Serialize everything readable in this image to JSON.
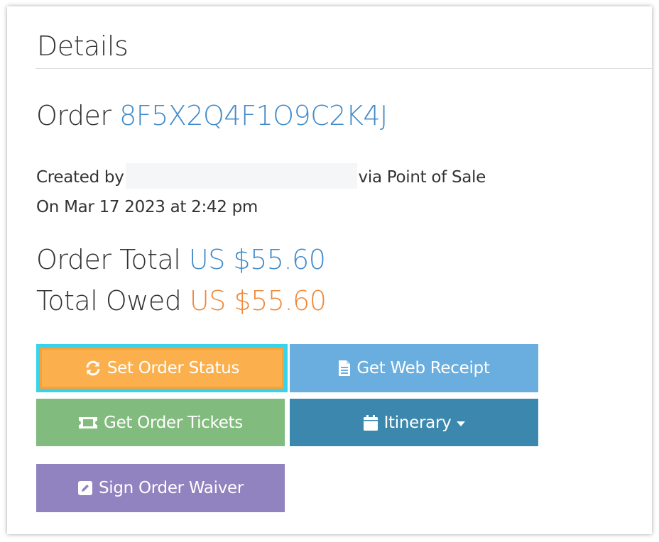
{
  "details": {
    "title": "Details"
  },
  "order": {
    "label": "Order",
    "id": "8F5X2Q4F1O9C2K4J",
    "created_by_label": "Created by",
    "via_text": "via Point of Sale",
    "created_on": "On Mar 17 2023 at 2:42 pm"
  },
  "totals": {
    "order_total_label": "Order Total",
    "order_total_value": "US $55.60",
    "total_owed_label": "Total Owed",
    "total_owed_value": "US $55.60"
  },
  "actions": {
    "set_status": {
      "label": "Set Order Status",
      "icon": "refresh-icon"
    },
    "web_receipt": {
      "label": "Get Web Receipt",
      "icon": "document-icon"
    },
    "tickets": {
      "label": "Get Order Tickets",
      "icon": "ticket-icon"
    },
    "itinerary": {
      "label": "Itinerary",
      "icon": "calendar-icon"
    },
    "waiver": {
      "label": "Sign Order Waiver",
      "icon": "edit-icon"
    }
  },
  "colors": {
    "link_blue": "#428bca",
    "owed_orange": "#f0883a",
    "status_button": "#fbb04d",
    "focus_ring": "#38d3ea",
    "receipt_button": "#6aaedf",
    "tickets_button": "#82bb7e",
    "itinerary_button": "#3b87ad",
    "waiver_button": "#9083bf"
  }
}
